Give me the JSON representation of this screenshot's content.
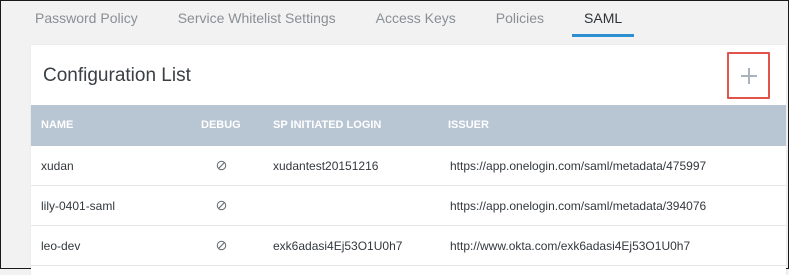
{
  "tabs": [
    {
      "label": "Password Policy"
    },
    {
      "label": "Service Whitelist Settings"
    },
    {
      "label": "Access Keys"
    },
    {
      "label": "Policies"
    },
    {
      "label": "SAML",
      "active": true
    }
  ],
  "panel": {
    "title": "Configuration List",
    "add_button_icon": "plus-icon"
  },
  "table": {
    "columns": [
      "NAME",
      "DEBUG",
      "SP INITIATED LOGIN",
      "ISSUER"
    ],
    "rows": [
      {
        "name": "xudan",
        "debug_icon": "disabled-icon",
        "sp_initiated_login": "xudantest20151216",
        "issuer": "https://app.onelogin.com/saml/metadata/475997"
      },
      {
        "name": "lily-0401-saml",
        "debug_icon": "disabled-icon",
        "sp_initiated_login": "",
        "issuer": "https://app.onelogin.com/saml/metadata/394076"
      },
      {
        "name": "leo-dev",
        "debug_icon": "disabled-icon",
        "sp_initiated_login": "exk6adasi4Ej53O1U0h7",
        "issuer": "http://www.okta.com/exk6adasi4Ej53O1U0h7"
      }
    ]
  },
  "colors": {
    "active_tab_underline": "#2b8fd0",
    "table_header_bg": "#b8c5d3",
    "add_button_border": "#e0544b"
  }
}
